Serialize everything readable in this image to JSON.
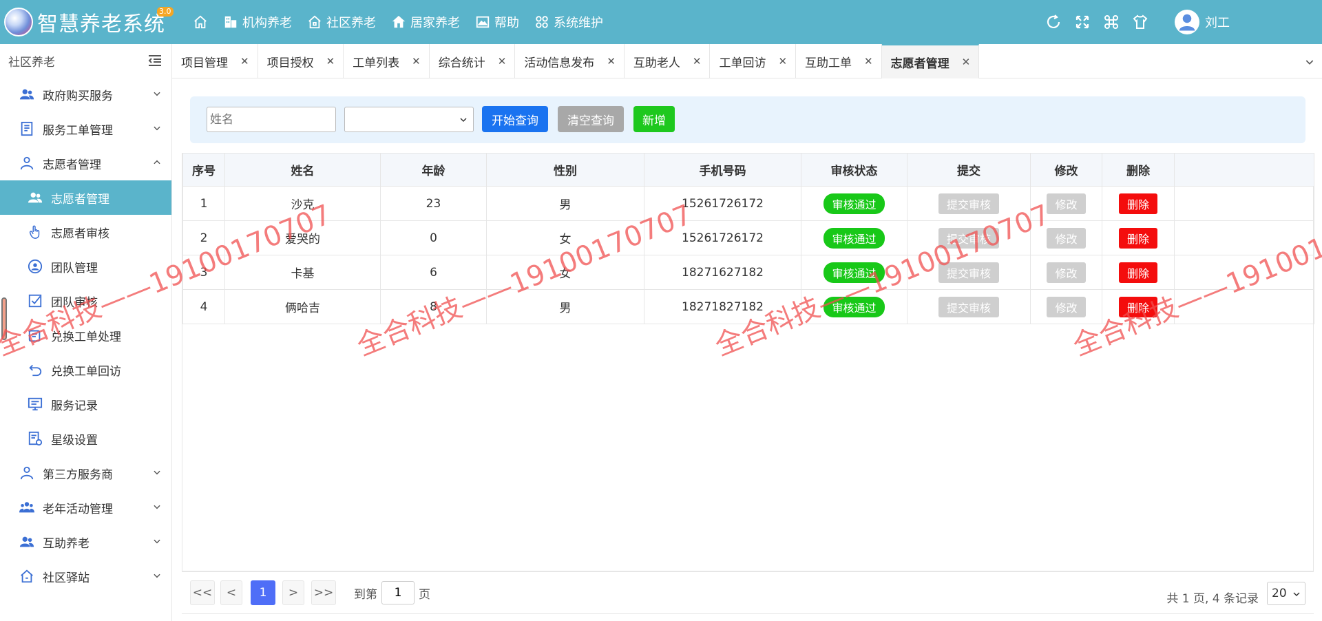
{
  "app": {
    "name": "智慧养老系统",
    "version": "3.0"
  },
  "topnav": [
    {
      "label": "",
      "icon": "home-icon"
    },
    {
      "label": "机构养老",
      "icon": "building-icon"
    },
    {
      "label": "社区养老",
      "icon": "house-outline-icon"
    },
    {
      "label": "居家养老",
      "icon": "house-filled-icon"
    },
    {
      "label": "帮助",
      "icon": "image-icon"
    },
    {
      "label": "系统维护",
      "icon": "grid-icon"
    }
  ],
  "user": {
    "name": "刘工"
  },
  "sidebar": {
    "title": "社区养老",
    "items": [
      {
        "label": "政府购买服务",
        "icon": "users-icon",
        "expandable": true
      },
      {
        "label": "服务工单管理",
        "icon": "document-icon",
        "expandable": true
      },
      {
        "label": "志愿者管理",
        "icon": "person-icon",
        "expandable": true,
        "expanded": true
      },
      {
        "label": "志愿者管理",
        "icon": "users-icon",
        "sub": true,
        "active": true
      },
      {
        "label": "志愿者审核",
        "icon": "hand-icon",
        "sub": true
      },
      {
        "label": "团队管理",
        "icon": "person-circle-icon",
        "sub": true
      },
      {
        "label": "团队审核",
        "icon": "checkbox-icon",
        "sub": true
      },
      {
        "label": "兑换工单处理",
        "icon": "ticket-icon",
        "sub": true
      },
      {
        "label": "兑换工单回访",
        "icon": "undo-icon",
        "sub": true
      },
      {
        "label": "服务记录",
        "icon": "monitor-icon",
        "sub": true
      },
      {
        "label": "星级设置",
        "icon": "settings-doc-icon",
        "sub": true
      },
      {
        "label": "第三方服务商",
        "icon": "person-icon",
        "expandable": true
      },
      {
        "label": "老年活动管理",
        "icon": "group-icon",
        "expandable": true
      },
      {
        "label": "互助养老",
        "icon": "users-icon",
        "expandable": true
      },
      {
        "label": "社区驿站",
        "icon": "house-outline-icon",
        "expandable": true
      }
    ]
  },
  "tabs": [
    {
      "label": "项目管理"
    },
    {
      "label": "项目授权"
    },
    {
      "label": "工单列表"
    },
    {
      "label": "综合统计"
    },
    {
      "label": "活动信息发布"
    },
    {
      "label": "互助老人"
    },
    {
      "label": "工单回访"
    },
    {
      "label": "互助工单"
    },
    {
      "label": "志愿者管理",
      "active": true
    }
  ],
  "search": {
    "name_placeholder": "姓名",
    "search_label": "开始查询",
    "clear_label": "清空查询",
    "add_label": "新增"
  },
  "table": {
    "headers": [
      "序号",
      "姓名",
      "年龄",
      "性别",
      "手机号码",
      "审核状态",
      "提交",
      "修改",
      "删除"
    ],
    "rows": [
      {
        "no": "1",
        "name": "沙克",
        "age": "23",
        "gender": "男",
        "phone": "15261726172",
        "status": "审核通过",
        "submit": "提交审核",
        "edit": "修改",
        "del": "删除"
      },
      {
        "no": "2",
        "name": "爱哭的",
        "age": "0",
        "gender": "女",
        "phone": "15261726172",
        "status": "审核通过",
        "submit": "提交审核",
        "edit": "修改",
        "del": "删除"
      },
      {
        "no": "3",
        "name": "卡基",
        "age": "6",
        "gender": "女",
        "phone": "18271627182",
        "status": "审核通过",
        "submit": "提交审核",
        "edit": "修改",
        "del": "删除"
      },
      {
        "no": "4",
        "name": "俩哈吉",
        "age": "8",
        "gender": "男",
        "phone": "18271827182",
        "status": "审核通过",
        "submit": "提交审核",
        "edit": "修改",
        "del": "删除"
      }
    ]
  },
  "pager": {
    "first": "<<",
    "prev": "<",
    "current": "1",
    "next": ">",
    "last": ">>",
    "goto_prefix": "到第",
    "goto_value": "1",
    "goto_suffix": "页",
    "info": "共 1 页, 4 条记录",
    "page_size": "20"
  },
  "watermark": "全合科技——19100170707",
  "colors": {
    "primary": "#5ab4cb",
    "blue": "#1a73f0",
    "green": "#1ec81e",
    "red": "#f40d0d"
  }
}
